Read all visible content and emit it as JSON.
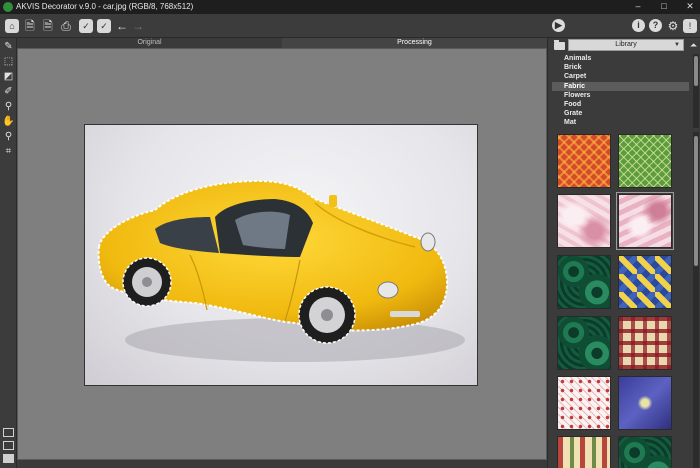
{
  "window": {
    "title": "AKVIS Decorator v.9.0 - car.jpg (RGB/8, 768x512)",
    "minimize": "–",
    "maximize": "□",
    "close": "✕"
  },
  "toolbar": {
    "icons": [
      "home-icon",
      "open-icon",
      "save-icon",
      "print-icon",
      "batch-icon",
      "settings-preset-icon",
      "undo-icon",
      "redo-icon",
      "run-icon",
      "about-icon",
      "help-icon",
      "preferences-icon",
      "notifications-icon"
    ],
    "about_glyph": "i",
    "help_glyph": "?",
    "preferences_glyph": "⚙",
    "notify_glyph": "!"
  },
  "left_tools": [
    "select-fragment-icon",
    "rectangle-selection-icon",
    "eraser-icon",
    "pencil-icon",
    "pin-icon",
    "hand-icon",
    "zoom-icon",
    "crop-icon"
  ],
  "view_tabs": {
    "original": "Original",
    "processing": "Processing",
    "active": "processing"
  },
  "library": {
    "dropdown_value": "Library",
    "categories": [
      "Animals",
      "Brick",
      "Carpet",
      "Fabric",
      "Flowers",
      "Food",
      "Grate",
      "Mat"
    ],
    "selected_category": "Fabric",
    "textures": [
      {
        "name": "red-gold-fabric",
        "selected": false
      },
      {
        "name": "green-fabric",
        "selected": false
      },
      {
        "name": "pink-marble-fabric",
        "selected": false
      },
      {
        "name": "pink-silk-fabric",
        "selected": true
      },
      {
        "name": "malachite-fabric",
        "selected": false
      },
      {
        "name": "harlequin-fabric",
        "selected": false
      },
      {
        "name": "malachite-fabric-2",
        "selected": false
      },
      {
        "name": "plaid-fabric",
        "selected": false
      },
      {
        "name": "lace-fabric",
        "selected": false
      },
      {
        "name": "blue-ribbon-fabric",
        "selected": false
      },
      {
        "name": "stripe-pattern-fabric",
        "selected": false
      },
      {
        "name": "malachite-fabric-3",
        "selected": false
      }
    ]
  },
  "colors": {
    "car_body": "#f3c21a",
    "background": "#3a3a3a",
    "canvas": "#7f7f7f"
  }
}
